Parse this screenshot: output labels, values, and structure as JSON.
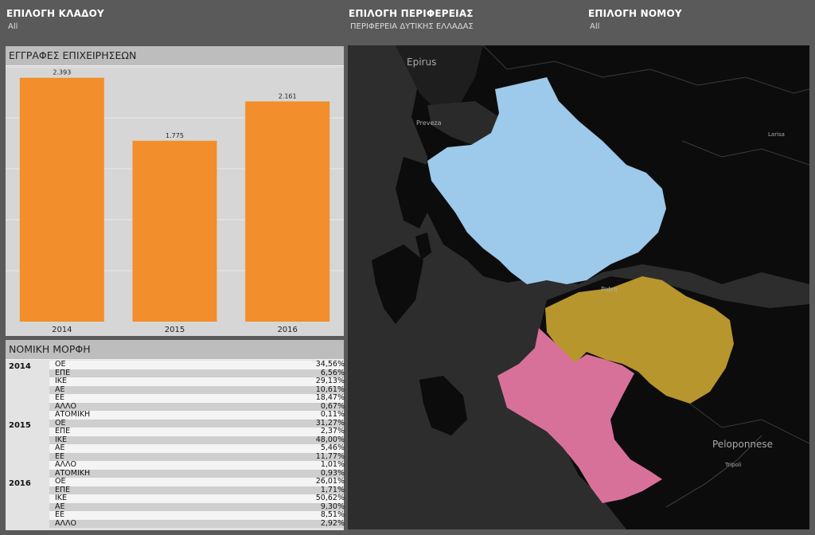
{
  "filters": [
    {
      "title": "ΕΠΙΛΟΓΗ ΚΛΑΔΟΥ",
      "value": "All"
    },
    {
      "title": "ΕΠΙΛΟΓΗ ΠΕΡΙΦΕΡΕΙΑΣ",
      "value": "ΠΕΡΙΦΕΡΕΙΑ ΔΥΤΙΚΗΣ ΕΛΛΑΔΑΣ"
    },
    {
      "title": "ΕΠΙΛΟΓΗ ΝΟΜΟΥ",
      "value": "All"
    }
  ],
  "chart_panel": {
    "title": "ΕΓΓΡΑΦΕΣ ΕΠΙΧΕΙΡΗΣΕΩΝ"
  },
  "chart_data": {
    "type": "bar",
    "categories": [
      "2014",
      "2015",
      "2016"
    ],
    "values": [
      2393,
      1775,
      2161
    ],
    "data_labels": [
      "2.393",
      "1.775",
      "2.161"
    ],
    "title": "ΕΓΓΡΑΦΕΣ ΕΠΙΧΕΙΡΗΣΕΩΝ",
    "ylim": [
      0,
      2500
    ],
    "grid": true,
    "colors": {
      "bar": "#f28e2b"
    }
  },
  "table_panel": {
    "title": "ΝΟΜΙΚΗ ΜΟΡΦΗ",
    "groups": [
      {
        "year": "2014",
        "rows": [
          [
            "ΟΕ",
            "34,56%"
          ],
          [
            "ΕΠΕ",
            "6,56%"
          ],
          [
            "ΙΚΕ",
            "29,13%"
          ],
          [
            "ΑΕ",
            "10,61%"
          ],
          [
            "ΕΕ",
            "18,47%"
          ],
          [
            "ΑΛΛΟ",
            "0,67%"
          ],
          [
            "ΑΤΟΜΙΚΗ",
            "0,11%"
          ]
        ]
      },
      {
        "year": "2015",
        "rows": [
          [
            "ΟΕ",
            "31,27%"
          ],
          [
            "ΕΠΕ",
            "2,37%"
          ],
          [
            "ΙΚΕ",
            "48,00%"
          ],
          [
            "ΑΕ",
            "5,46%"
          ],
          [
            "ΕΕ",
            "11,77%"
          ],
          [
            "ΑΛΛΟ",
            "1,01%"
          ],
          [
            "ΑΤΟΜΙΚΗ",
            "0,93%"
          ]
        ]
      },
      {
        "year": "2016",
        "rows": [
          [
            "ΟΕ",
            "26,01%"
          ],
          [
            "ΕΠΕ",
            "1,71%"
          ],
          [
            "ΙΚΕ",
            "50,62%"
          ],
          [
            "ΑΕ",
            "9,30%"
          ],
          [
            "ΕΕ",
            "8,51%"
          ],
          [
            "ΑΛΛΟ",
            "2,92%"
          ]
        ]
      }
    ]
  },
  "map": {
    "labels": [
      "Epirus",
      "Preveza",
      "Patra",
      "Peloponnese",
      "Tripoli",
      "Larisa"
    ],
    "colors": {
      "aitoloakarnania": "#9dc9ea",
      "achaia": "#b8962e",
      "ilia": "#d8719a",
      "land": "#0c0c0c",
      "sea": "#2d2d2d"
    }
  }
}
